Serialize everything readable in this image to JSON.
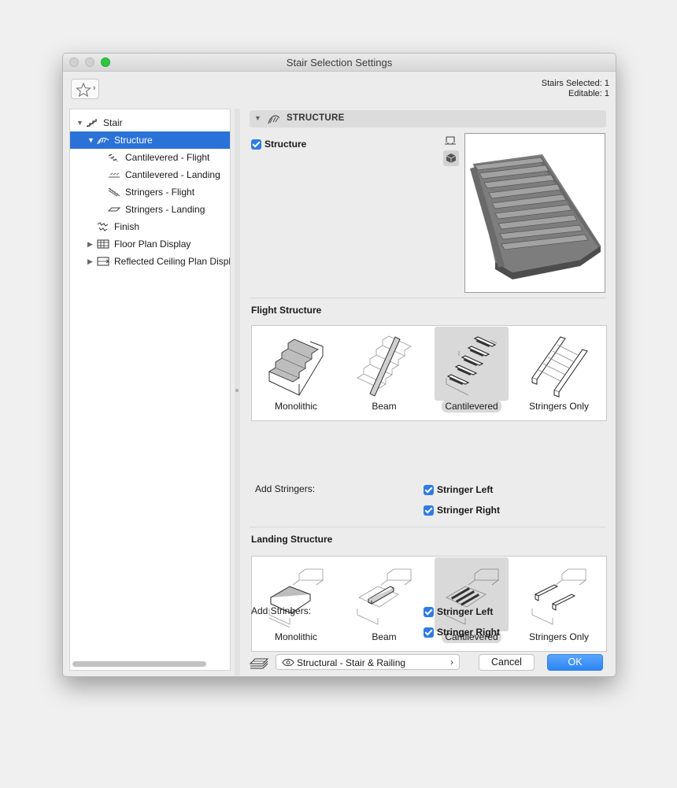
{
  "window": {
    "title": "Stair Selection Settings"
  },
  "selection_info": {
    "selected": "Stairs Selected: 1",
    "editable": "Editable: 1"
  },
  "tree": {
    "items": [
      {
        "label": "Stair"
      },
      {
        "label": "Structure"
      },
      {
        "label": "Cantilevered - Flight"
      },
      {
        "label": "Cantilevered - Landing"
      },
      {
        "label": "Stringers - Flight"
      },
      {
        "label": "Stringers - Landing"
      },
      {
        "label": "Finish"
      },
      {
        "label": "Floor Plan Display"
      },
      {
        "label": "Reflected Ceiling Plan Displ"
      }
    ]
  },
  "section": {
    "title": "STRUCTURE",
    "structure_checkbox": "Structure"
  },
  "flight": {
    "heading": "Flight Structure",
    "options": [
      "Monolithic",
      "Beam",
      "Cantilevered",
      "Stringers Only"
    ],
    "selected": "Cantilevered",
    "add_stringers_label": "Add Stringers:",
    "stringer_left": "Stringer Left",
    "stringer_right": "Stringer Right"
  },
  "landing": {
    "heading": "Landing Structure",
    "options": [
      "Monolithic",
      "Beam",
      "Cantilevered",
      "Stringers Only"
    ],
    "selected": "Cantilevered",
    "add_stringers_label": "Add Stringers:",
    "stringer_left": "Stringer Left",
    "stringer_right": "Stringer Right"
  },
  "footer": {
    "view": "Structural - Stair & Railing",
    "cancel": "Cancel",
    "ok": "OK"
  },
  "colors": {
    "accent": "#2a72d7",
    "ok_button": "#2e84f4",
    "checkbox": "#2f7be5"
  }
}
